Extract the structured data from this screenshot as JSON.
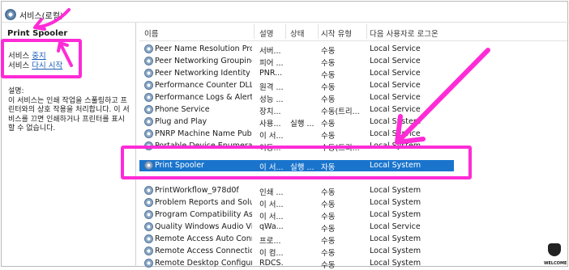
{
  "window": {
    "title": "서비스(로컬)"
  },
  "left_pane": {
    "service_name": "Print Spooler",
    "stop_prefix": "서비스 ",
    "stop_link": "중지",
    "restart_prefix": "서비스 ",
    "restart_link": "다시 시작",
    "description_label": "설명:",
    "description": "이 서비스는 인쇄 작업을 스풀링하고 프린터와의 상호 작용을 처리합니다. 이 서비스를 끄면 인쇄하거나 프린터를 표시할 수 없습니다."
  },
  "columns": [
    "이름",
    "설명",
    "상태",
    "시작 유형",
    "다음 사용자로 로그온"
  ],
  "rows": [
    {
      "name": "Peer Name Resolution Prot...",
      "desc": "서버...",
      "status": "",
      "start": "수동",
      "logon": "Local Service"
    },
    {
      "name": "Peer Networking Grouping",
      "desc": "피어 ...",
      "status": "",
      "start": "수동",
      "logon": "Local Service"
    },
    {
      "name": "Peer Networking Identity M...",
      "desc": "PNR...",
      "status": "",
      "start": "수동",
      "logon": "Local Service"
    },
    {
      "name": "Performance Counter DLL H...",
      "desc": "원격 ...",
      "status": "",
      "start": "수동",
      "logon": "Local Service"
    },
    {
      "name": "Performance Logs & Alerts",
      "desc": "성능 ...",
      "status": "",
      "start": "수동",
      "logon": "Local Service"
    },
    {
      "name": "Phone Service",
      "desc": "장치...",
      "status": "",
      "start": "수동(트리...",
      "logon": "Local Service"
    },
    {
      "name": "Plug and Play",
      "desc": "사용...",
      "status": "실행 ...",
      "start": "수동",
      "logon": "Local System"
    },
    {
      "name": "PNRP Machine Name Publi...",
      "desc": "이 서...",
      "status": "",
      "start": "수동",
      "logon": "Local Service"
    },
    {
      "name": "Portable Device Enumerator...",
      "desc": "이동...",
      "status": "",
      "start": "수동(트리...",
      "logon": "Local System"
    },
    {
      "name": "Print Spooler",
      "desc": "이 서...",
      "status": "실행 ...",
      "start": "자동",
      "logon": "Local System",
      "selected": true
    },
    {
      "name": "PrintWorkflow_978d0f",
      "desc": "인쇄 ...",
      "status": "",
      "start": "수동",
      "logon": "Local System"
    },
    {
      "name": "Problem Reports and Soluti...",
      "desc": "이 서...",
      "status": "",
      "start": "수동",
      "logon": "Local System"
    },
    {
      "name": "Program Compatibility Assi...",
      "desc": "이 서...",
      "status": "",
      "start": "수동",
      "logon": "Local System"
    },
    {
      "name": "Quality Windows Audio Vid...",
      "desc": "qWa...",
      "status": "",
      "start": "수동",
      "logon": "Local Service"
    },
    {
      "name": "Remote Access Auto Conne...",
      "desc": "프로...",
      "status": "",
      "start": "수동",
      "logon": "Local System"
    },
    {
      "name": "Remote Access Connection ...",
      "desc": "이 컴...",
      "status": "",
      "start": "수동",
      "logon": "Local System"
    },
    {
      "name": "Remote Desktop Configurat...",
      "desc": "RDCS...",
      "status": "",
      "start": "수동",
      "logon": "Local System"
    }
  ],
  "watermark": {
    "text": "WELCOME"
  },
  "annotation_color": "#ff2bd6"
}
